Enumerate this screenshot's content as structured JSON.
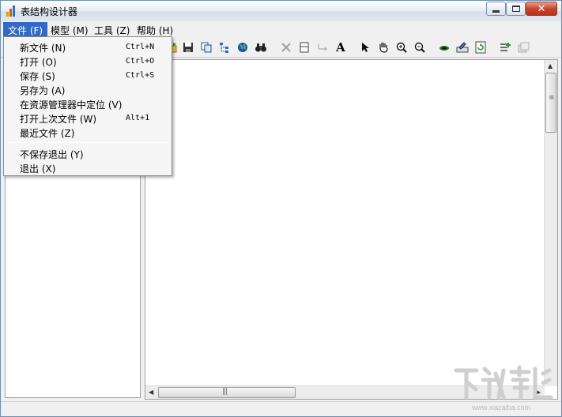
{
  "window": {
    "title": "表结构设计器"
  },
  "menubar": [
    {
      "label": "文件 (F)"
    },
    {
      "label": "模型 (M)"
    },
    {
      "label": "工具 (Z)"
    },
    {
      "label": "帮助 (H)"
    }
  ],
  "file_menu": {
    "items": [
      {
        "label": "新文件 (N)",
        "shortcut": "Ctrl+N"
      },
      {
        "label": "打开 (O)",
        "shortcut": "Ctrl+O"
      },
      {
        "label": "保存 (S)",
        "shortcut": "Ctrl+S"
      },
      {
        "label": "另存为 (A)",
        "shortcut": ""
      },
      {
        "label": "在资源管理器中定位 (V)",
        "shortcut": ""
      },
      {
        "label": "打开上次文件 (W)",
        "shortcut": "Alt+1"
      },
      {
        "label": "最近文件 (Z)",
        "shortcut": ""
      },
      {
        "label": "不保存退出 (Y)",
        "shortcut": ""
      },
      {
        "label": "退出 (X)",
        "shortcut": ""
      }
    ]
  },
  "toolbar": {
    "icons": [
      "open-icon",
      "save-icon",
      "copy-icon",
      "tree-icon",
      "globe-icon",
      "binoculars-icon",
      "delete-icon",
      "table-icon",
      "connector-icon",
      "text-icon",
      "pointer-icon",
      "hand-icon",
      "zoom-in-icon",
      "zoom-out-icon",
      "view-icon",
      "edit-icon",
      "refresh-icon",
      "add-field-icon",
      "properties-icon"
    ],
    "text_tool": "A"
  },
  "watermark": {
    "url": "www.xiazaiba.com"
  },
  "colors": {
    "menu_highlight": "#3169c6",
    "close_button": "#c8442a"
  }
}
